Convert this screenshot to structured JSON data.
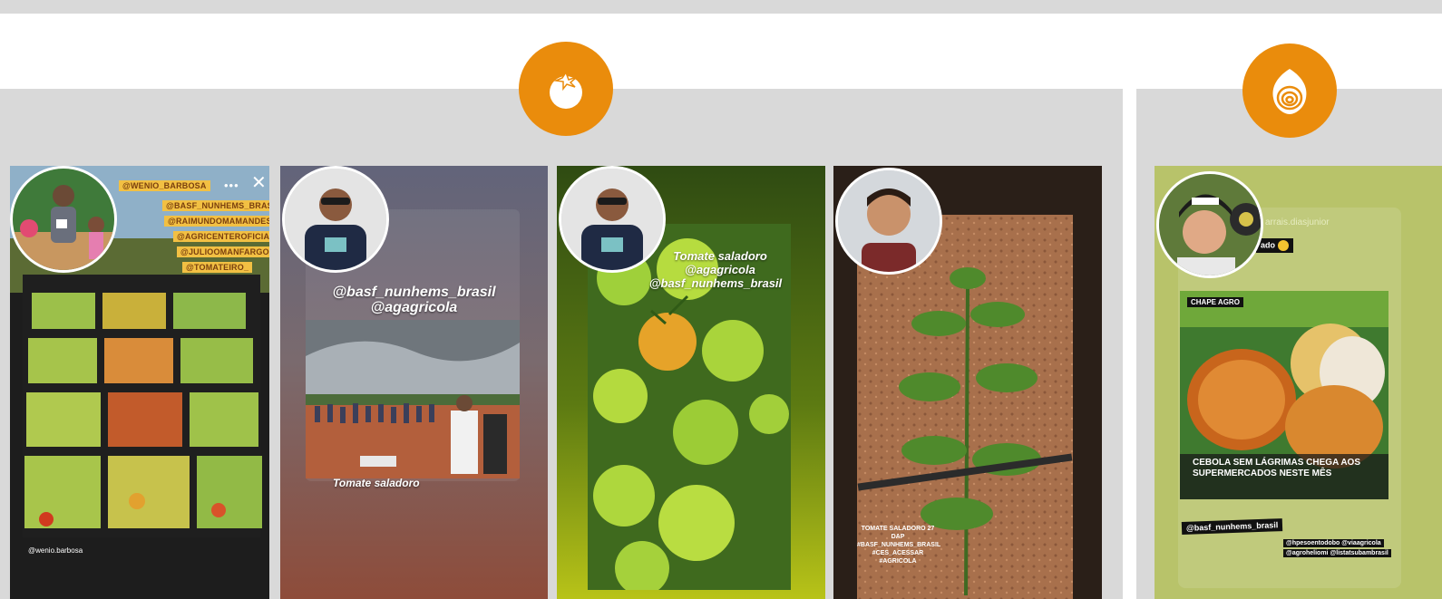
{
  "colors": {
    "accent": "#ea8c0c",
    "panel": "#d9d9d9",
    "tag_bg": "#f2c043"
  },
  "categories": [
    {
      "icon": "tomato-icon"
    },
    {
      "icon": "onion-icon"
    }
  ],
  "stories": {
    "s1": {
      "tags": [
        "@WENIO_BARBOSA",
        "@BASF_NUNHEMS_BRASIL",
        "@RAIMUNDOMAMANDES",
        "@AGRICENTEROFICIAL",
        "@JULIOOMANFARGOA",
        "@TOMATEIRO_"
      ],
      "caption": "@wenio.barbosa"
    },
    "s2": {
      "line1": "@basf_nunhems_brasil",
      "line2": "@agagricola",
      "caption": "Tomate saladoro"
    },
    "s3": {
      "line1": "Tomate saladoro",
      "line2": "@agagricola",
      "line3": "@basf_nunhems_brasil"
    },
    "s4": {
      "caption": "TOMATE SALADORO 27 DAP #BASF_NUNHEMS_BRASIL #CES_ACESSAR #AGRICOLA"
    },
    "s5": {
      "header": "arrais.diasjunior",
      "pill": "ado",
      "brand": "CHAPE AGRO",
      "headline": "CEBOLA SEM LÁGRIMAS CHEGA AOS SUPERMERCADOS NESTE MÊS",
      "tag_left": "@basf_nunhems_brasil",
      "tag_right_1": "@hpesoentodobo @viaagricola",
      "tag_right_2": "@agroheliomi @listatsubambrasil"
    }
  }
}
